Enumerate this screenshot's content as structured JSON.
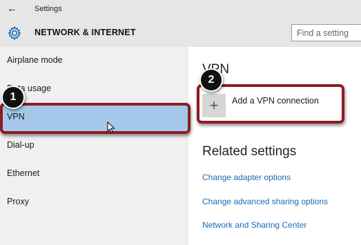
{
  "titlebar": {
    "title": "Settings",
    "back_icon": "back-arrow-icon"
  },
  "header": {
    "title": "NETWORK & INTERNET",
    "icon": "gear-icon",
    "search_placeholder": "Find a setting"
  },
  "sidebar": {
    "items": [
      {
        "label": "Airplane mode",
        "selected": false
      },
      {
        "label": "Data usage",
        "selected": false
      },
      {
        "label": "VPN",
        "selected": true
      },
      {
        "label": "Dial-up",
        "selected": false
      },
      {
        "label": "Ethernet",
        "selected": false
      },
      {
        "label": "Proxy",
        "selected": false
      }
    ]
  },
  "main": {
    "heading": "VPN",
    "add_vpn": {
      "icon": "plus-icon",
      "label": "Add a VPN connection"
    },
    "related_heading": "Related settings",
    "links": [
      "Change adapter options",
      "Change advanced sharing options",
      "Network and Sharing Center"
    ]
  },
  "annotations": {
    "step1": "1",
    "step2": "2",
    "callout_color": "#8e1b25"
  },
  "colors": {
    "selected_bg": "#a5c8ea",
    "link": "#1a68b5",
    "header_bg": "#e6e6e6",
    "sidebar_bg": "#f0f0f0"
  }
}
